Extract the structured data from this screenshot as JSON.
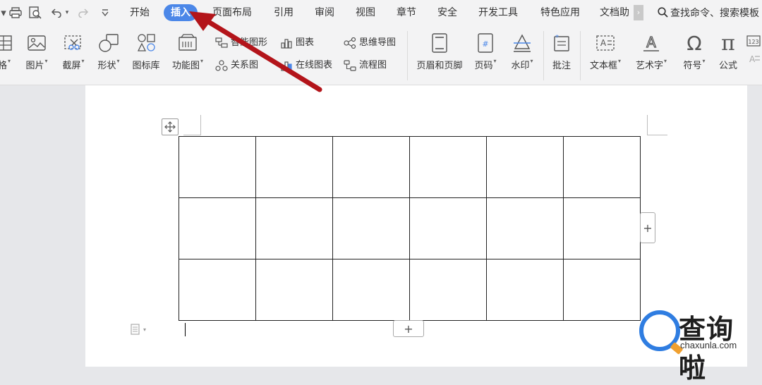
{
  "menubar": {
    "tabs": [
      {
        "label": "开始"
      },
      {
        "label": "插入"
      },
      {
        "label": "页面布局"
      },
      {
        "label": "引用"
      },
      {
        "label": "审阅"
      },
      {
        "label": "视图"
      },
      {
        "label": "章节"
      },
      {
        "label": "安全"
      },
      {
        "label": "开发工具"
      },
      {
        "label": "特色应用"
      },
      {
        "label": "文档助"
      }
    ],
    "active_tab": "插入",
    "search_label": "查找命令、搜索模板"
  },
  "ribbon": {
    "table_label": "格",
    "picture_label": "图片",
    "screenshot_label": "截屏",
    "shapes_label": "形状",
    "icon_library_label": "图标库",
    "function_chart_label": "功能图",
    "smart_graphic_label": "智能图形",
    "relation_chart_label": "关系图",
    "chart_label": "图表",
    "online_chart_label": "在线图表",
    "mind_map_label": "思维导图",
    "flowchart_label": "流程图",
    "header_footer_label": "页眉和页脚",
    "page_number_label": "页码",
    "watermark_label": "水印",
    "comment_label": "批注",
    "textbox_label": "文本框",
    "wordart_label": "艺术字",
    "symbol_label": "符号",
    "formula_label": "公式"
  },
  "document": {
    "table": {
      "rows": 3,
      "cols": 6
    },
    "add_symbol": "+"
  },
  "watermark_logo": {
    "cn_text": "查询啦",
    "en_text": "chaxunla.com"
  },
  "colors": {
    "active_tab_bg": "#4b87e8",
    "annotation_arrow": "#b3141a",
    "logo_blue": "#2f7de1"
  }
}
